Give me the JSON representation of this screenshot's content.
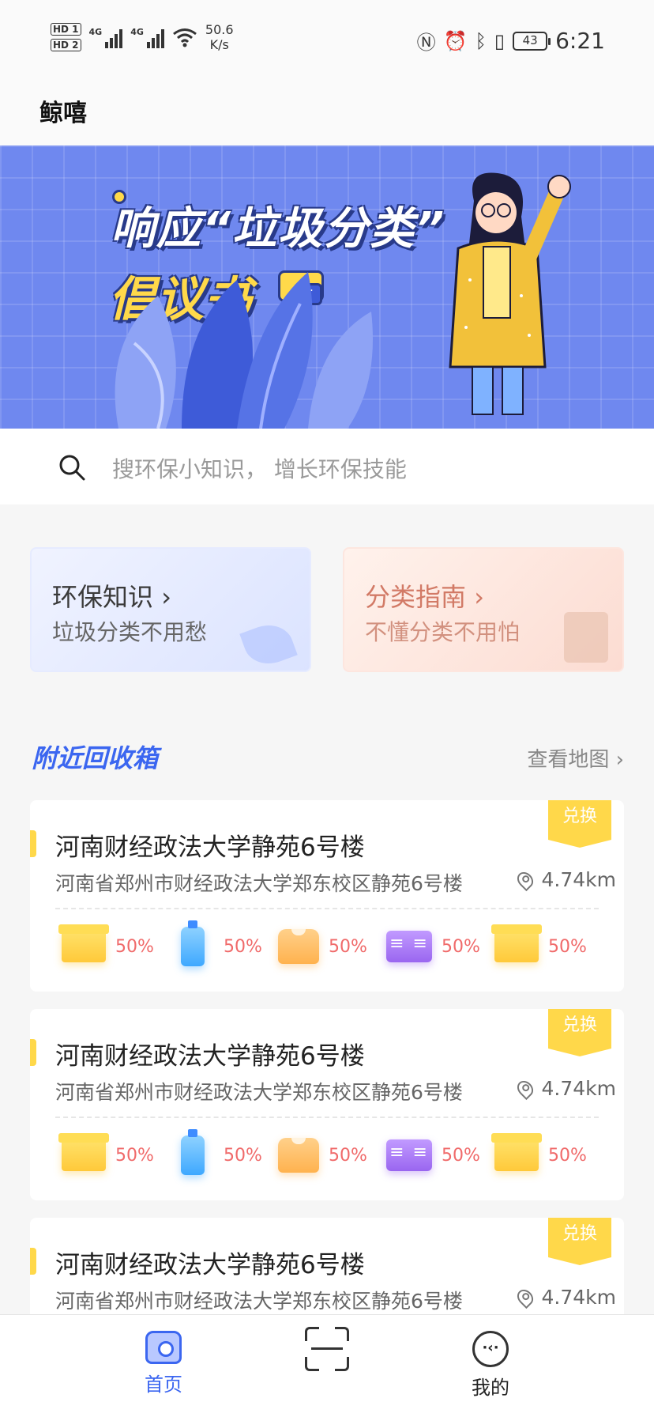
{
  "status_bar": {
    "sim1": "HD 1",
    "sim2": "HD 2",
    "net1": "4G",
    "net2": "4G",
    "speed_value": "50.6",
    "speed_unit": "K/s",
    "battery": "43",
    "time": "6:21",
    "icons": [
      "nfc-icon",
      "alarm-icon",
      "bluetooth-icon",
      "vibrate-icon",
      "battery-icon"
    ]
  },
  "app": {
    "title": "鲸嘻"
  },
  "banner": {
    "line1": "响应“垃圾分类”",
    "line2": "倡议书"
  },
  "search": {
    "placeholder": "搜环保小知识， 增长环保技能"
  },
  "cards": [
    {
      "title": "环保知识",
      "subtitle": "垃圾分类不用愁"
    },
    {
      "title": "分类指南",
      "subtitle": "不懂分类不用怕"
    }
  ],
  "section": {
    "title": "附近回收箱",
    "link": "查看地图"
  },
  "recycle_items": [
    {
      "name": "河南财经政法大学静苑6号楼",
      "address": "河南省郑州市财经政法大学郑东校区静苑6号楼",
      "distance": "4.74km",
      "badge": "兑换",
      "slots": [
        {
          "icon": "paper-box-icon",
          "percent": "50%"
        },
        {
          "icon": "plastic-bottle-icon",
          "percent": "50%"
        },
        {
          "icon": "clothes-icon",
          "percent": "50%"
        },
        {
          "icon": "book-icon",
          "percent": "50%"
        },
        {
          "icon": "paper-box-icon",
          "percent": "50%"
        }
      ]
    },
    {
      "name": "河南财经政法大学静苑6号楼",
      "address": "河南省郑州市财经政法大学郑东校区静苑6号楼",
      "distance": "4.74km",
      "badge": "兑换",
      "slots": [
        {
          "icon": "paper-box-icon",
          "percent": "50%"
        },
        {
          "icon": "plastic-bottle-icon",
          "percent": "50%"
        },
        {
          "icon": "clothes-icon",
          "percent": "50%"
        },
        {
          "icon": "book-icon",
          "percent": "50%"
        },
        {
          "icon": "paper-box-icon",
          "percent": "50%"
        }
      ]
    },
    {
      "name": "河南财经政法大学静苑6号楼",
      "address": "河南省郑州市财经政法大学郑东校区静苑6号楼",
      "distance": "4.74km",
      "badge": "兑换"
    }
  ],
  "tabs": [
    {
      "label": "首页",
      "icon": "home-icon",
      "active": true
    },
    {
      "label": "",
      "icon": "scan-icon",
      "active": false
    },
    {
      "label": "我的",
      "icon": "profile-icon",
      "active": false
    }
  ],
  "colors": {
    "accent": "#3b66f0",
    "badge": "#ffd84a",
    "percent": "#f06a6a",
    "banner": "#6f88ef"
  }
}
